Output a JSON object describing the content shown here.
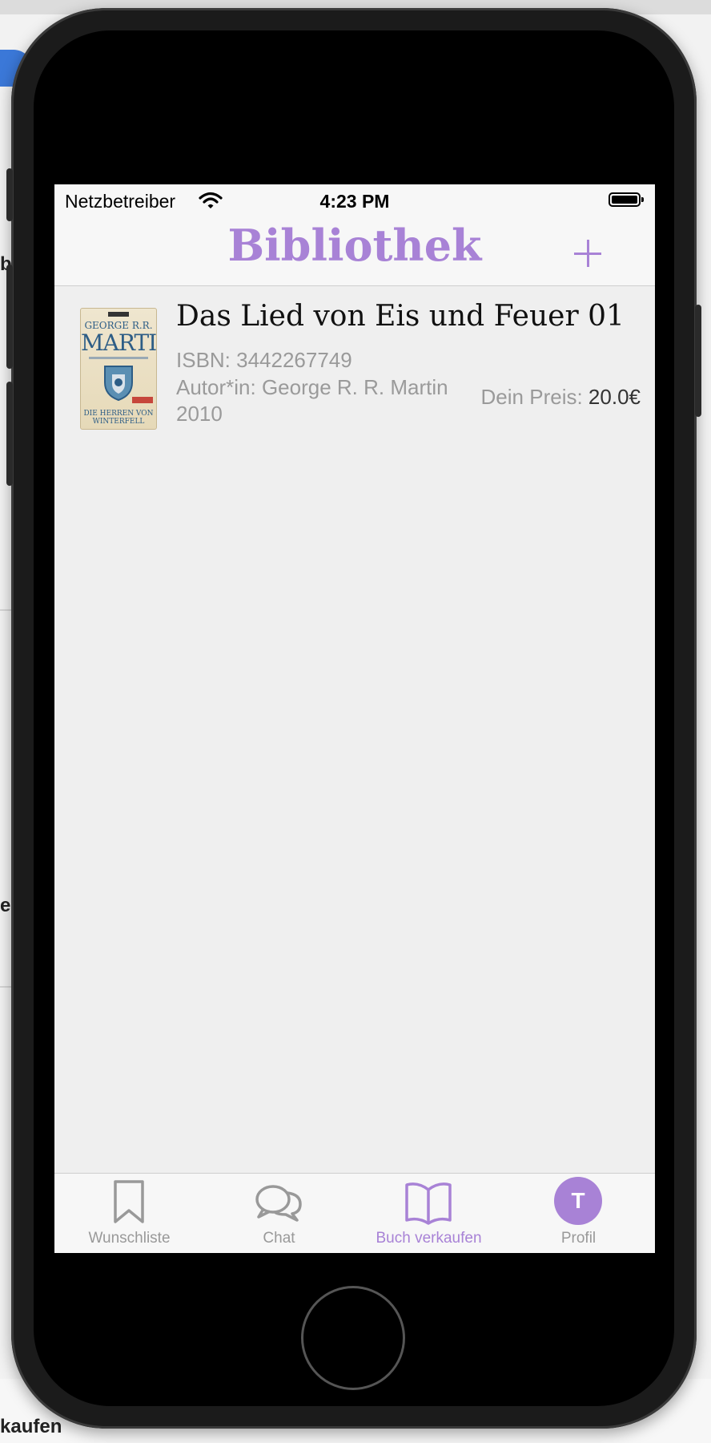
{
  "status_bar": {
    "carrier": "Netzbetreiber",
    "time": "4:23 PM"
  },
  "nav": {
    "title": "Bibliothek",
    "add_icon": "plus-icon"
  },
  "books": [
    {
      "title": "Das Lied von Eis und Feuer 01",
      "isbn": "ISBN: 3442267749",
      "author": "Autor*in: George R. R. Martin",
      "year": "2010",
      "price_label": "Dein Preis:",
      "price_value": "20.0€",
      "cover": {
        "author_top": "GEORGE R.R.",
        "author": "MARTIN",
        "title": "DIE HERREN VON WINTERFELL"
      }
    }
  ],
  "tabs": [
    {
      "label": "Wunschliste",
      "icon": "bookmark-icon",
      "active": false
    },
    {
      "label": "Chat",
      "icon": "chat-bubbles-icon",
      "active": false
    },
    {
      "label": "Buch verkaufen",
      "icon": "open-book-icon",
      "active": true
    },
    {
      "label": "Profil",
      "icon": "avatar-icon",
      "avatar_letter": "T",
      "active": false
    }
  ],
  "background_app": {
    "fragments": [
      "be",
      "e",
      "kaufen"
    ]
  },
  "colors": {
    "accent": "#a882d6",
    "inactive": "#999999",
    "background": "#efefef"
  }
}
